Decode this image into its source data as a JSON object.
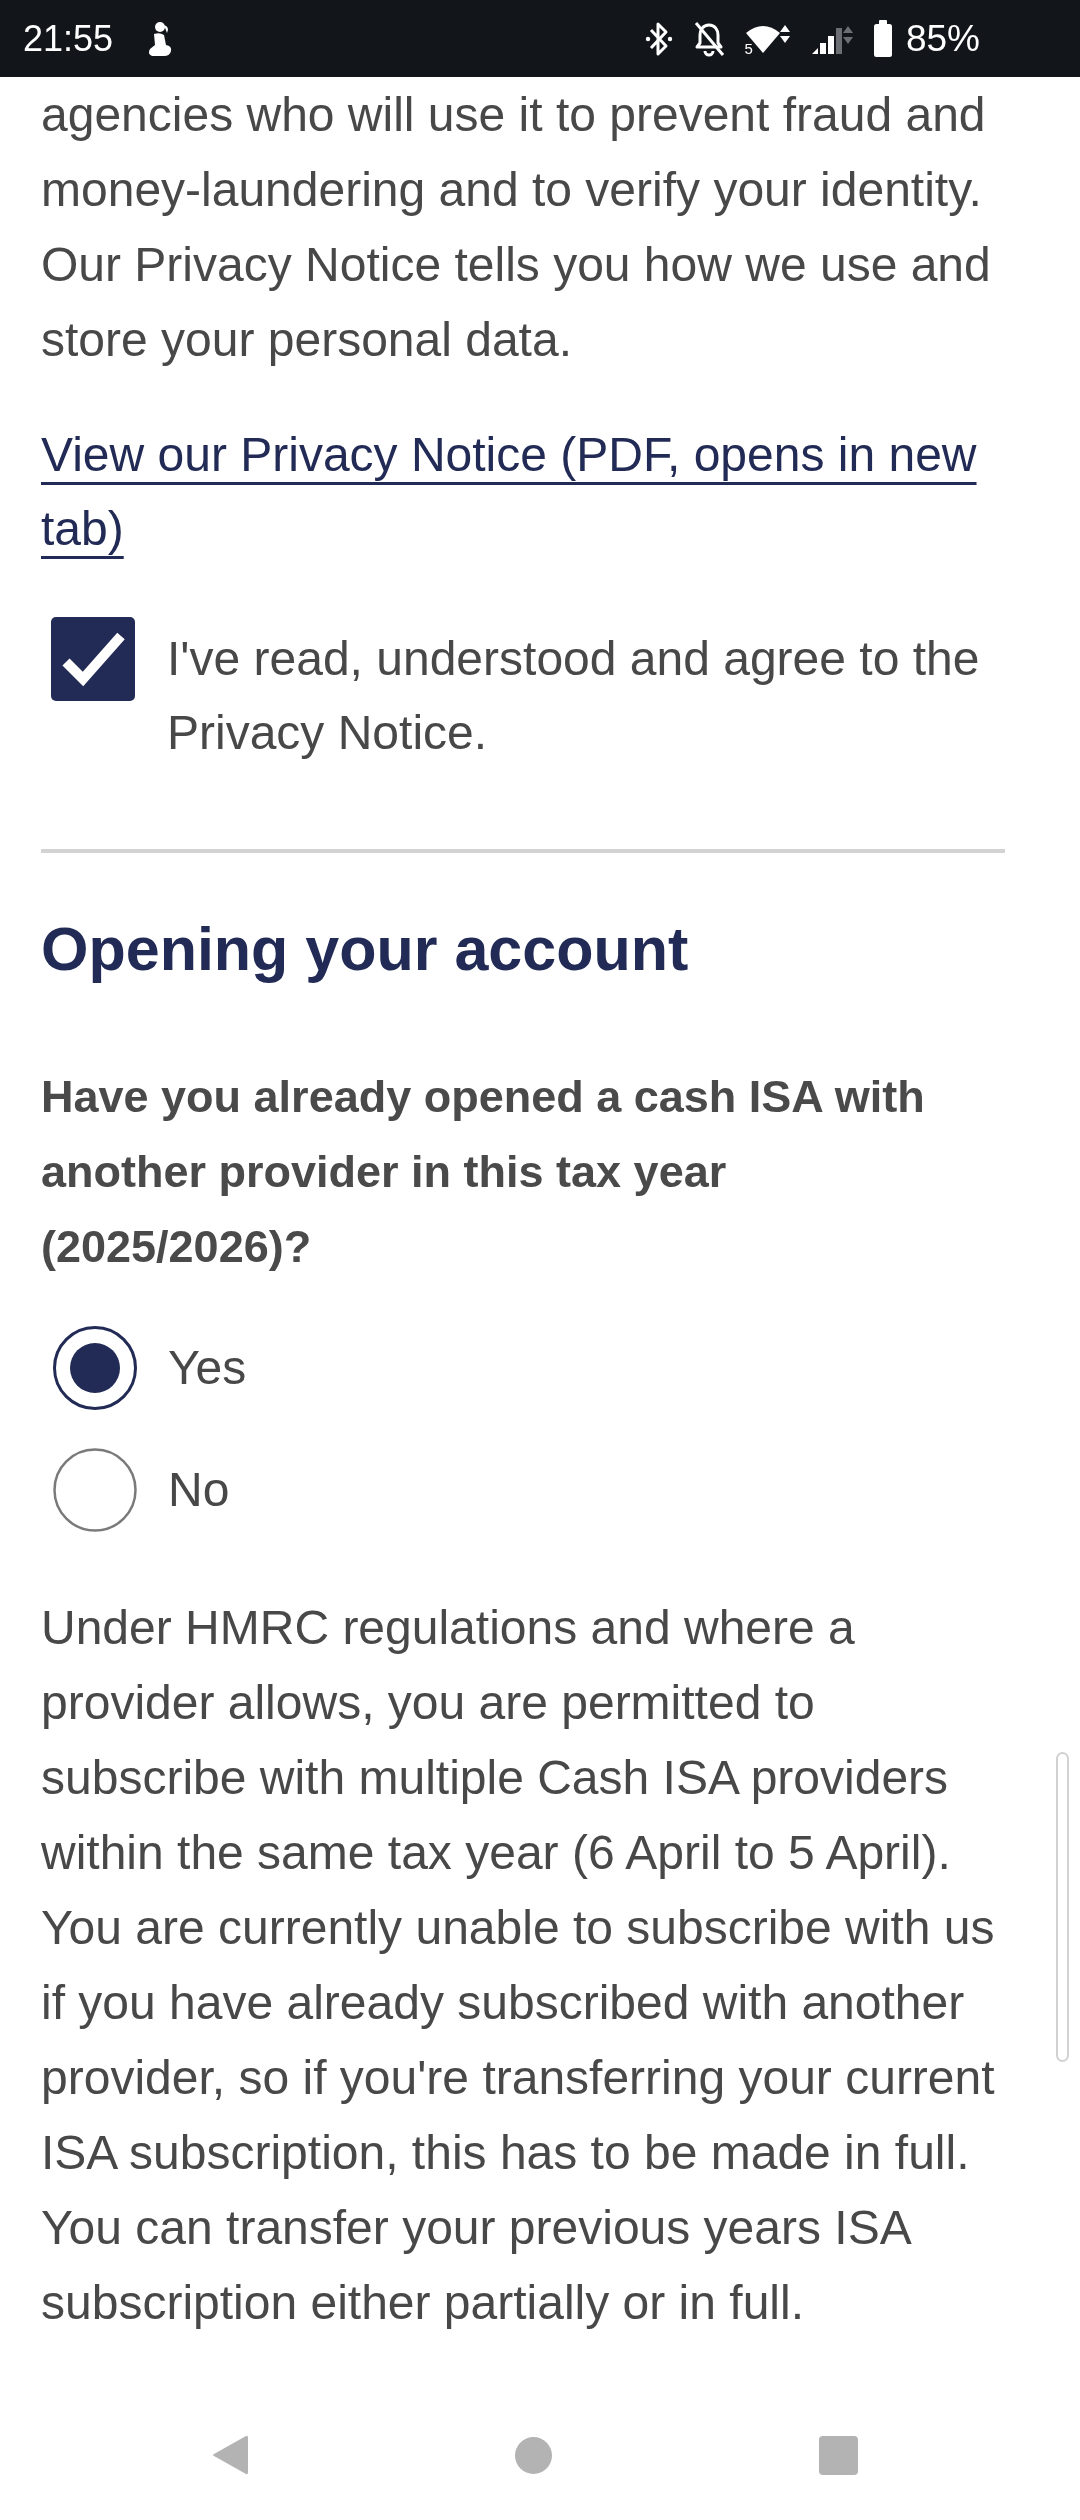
{
  "status_bar": {
    "time": "21:55",
    "wifi_label": "5",
    "battery": "85%"
  },
  "privacy": {
    "text": "agencies who will use it to prevent fraud and money-laundering and to verify your identity. Our Privacy Notice tells you how we use and store your personal data.",
    "link": "View our Privacy Notice (PDF, opens in new tab)",
    "consent": {
      "label": "I've read, understood and agree to the Privacy Notice.",
      "checked": true
    }
  },
  "section": {
    "heading": "Opening your account",
    "question": "Have you already opened a cash ISA with another provider in this tax year (2025/2026)?",
    "options": [
      {
        "label": "Yes",
        "selected": true
      },
      {
        "label": "No",
        "selected": false
      }
    ],
    "info": "Under HMRC regulations and where a provider allows, you are permitted to subscribe with multiple Cash ISA providers within the same tax year (6 April to 5 April). You are currently unable to subscribe with us if you have already subscribed with another provider, so if you're transferring your current ISA subscription, this has to be made in full. You can transfer your previous years ISA subscription either partially or in full."
  }
}
